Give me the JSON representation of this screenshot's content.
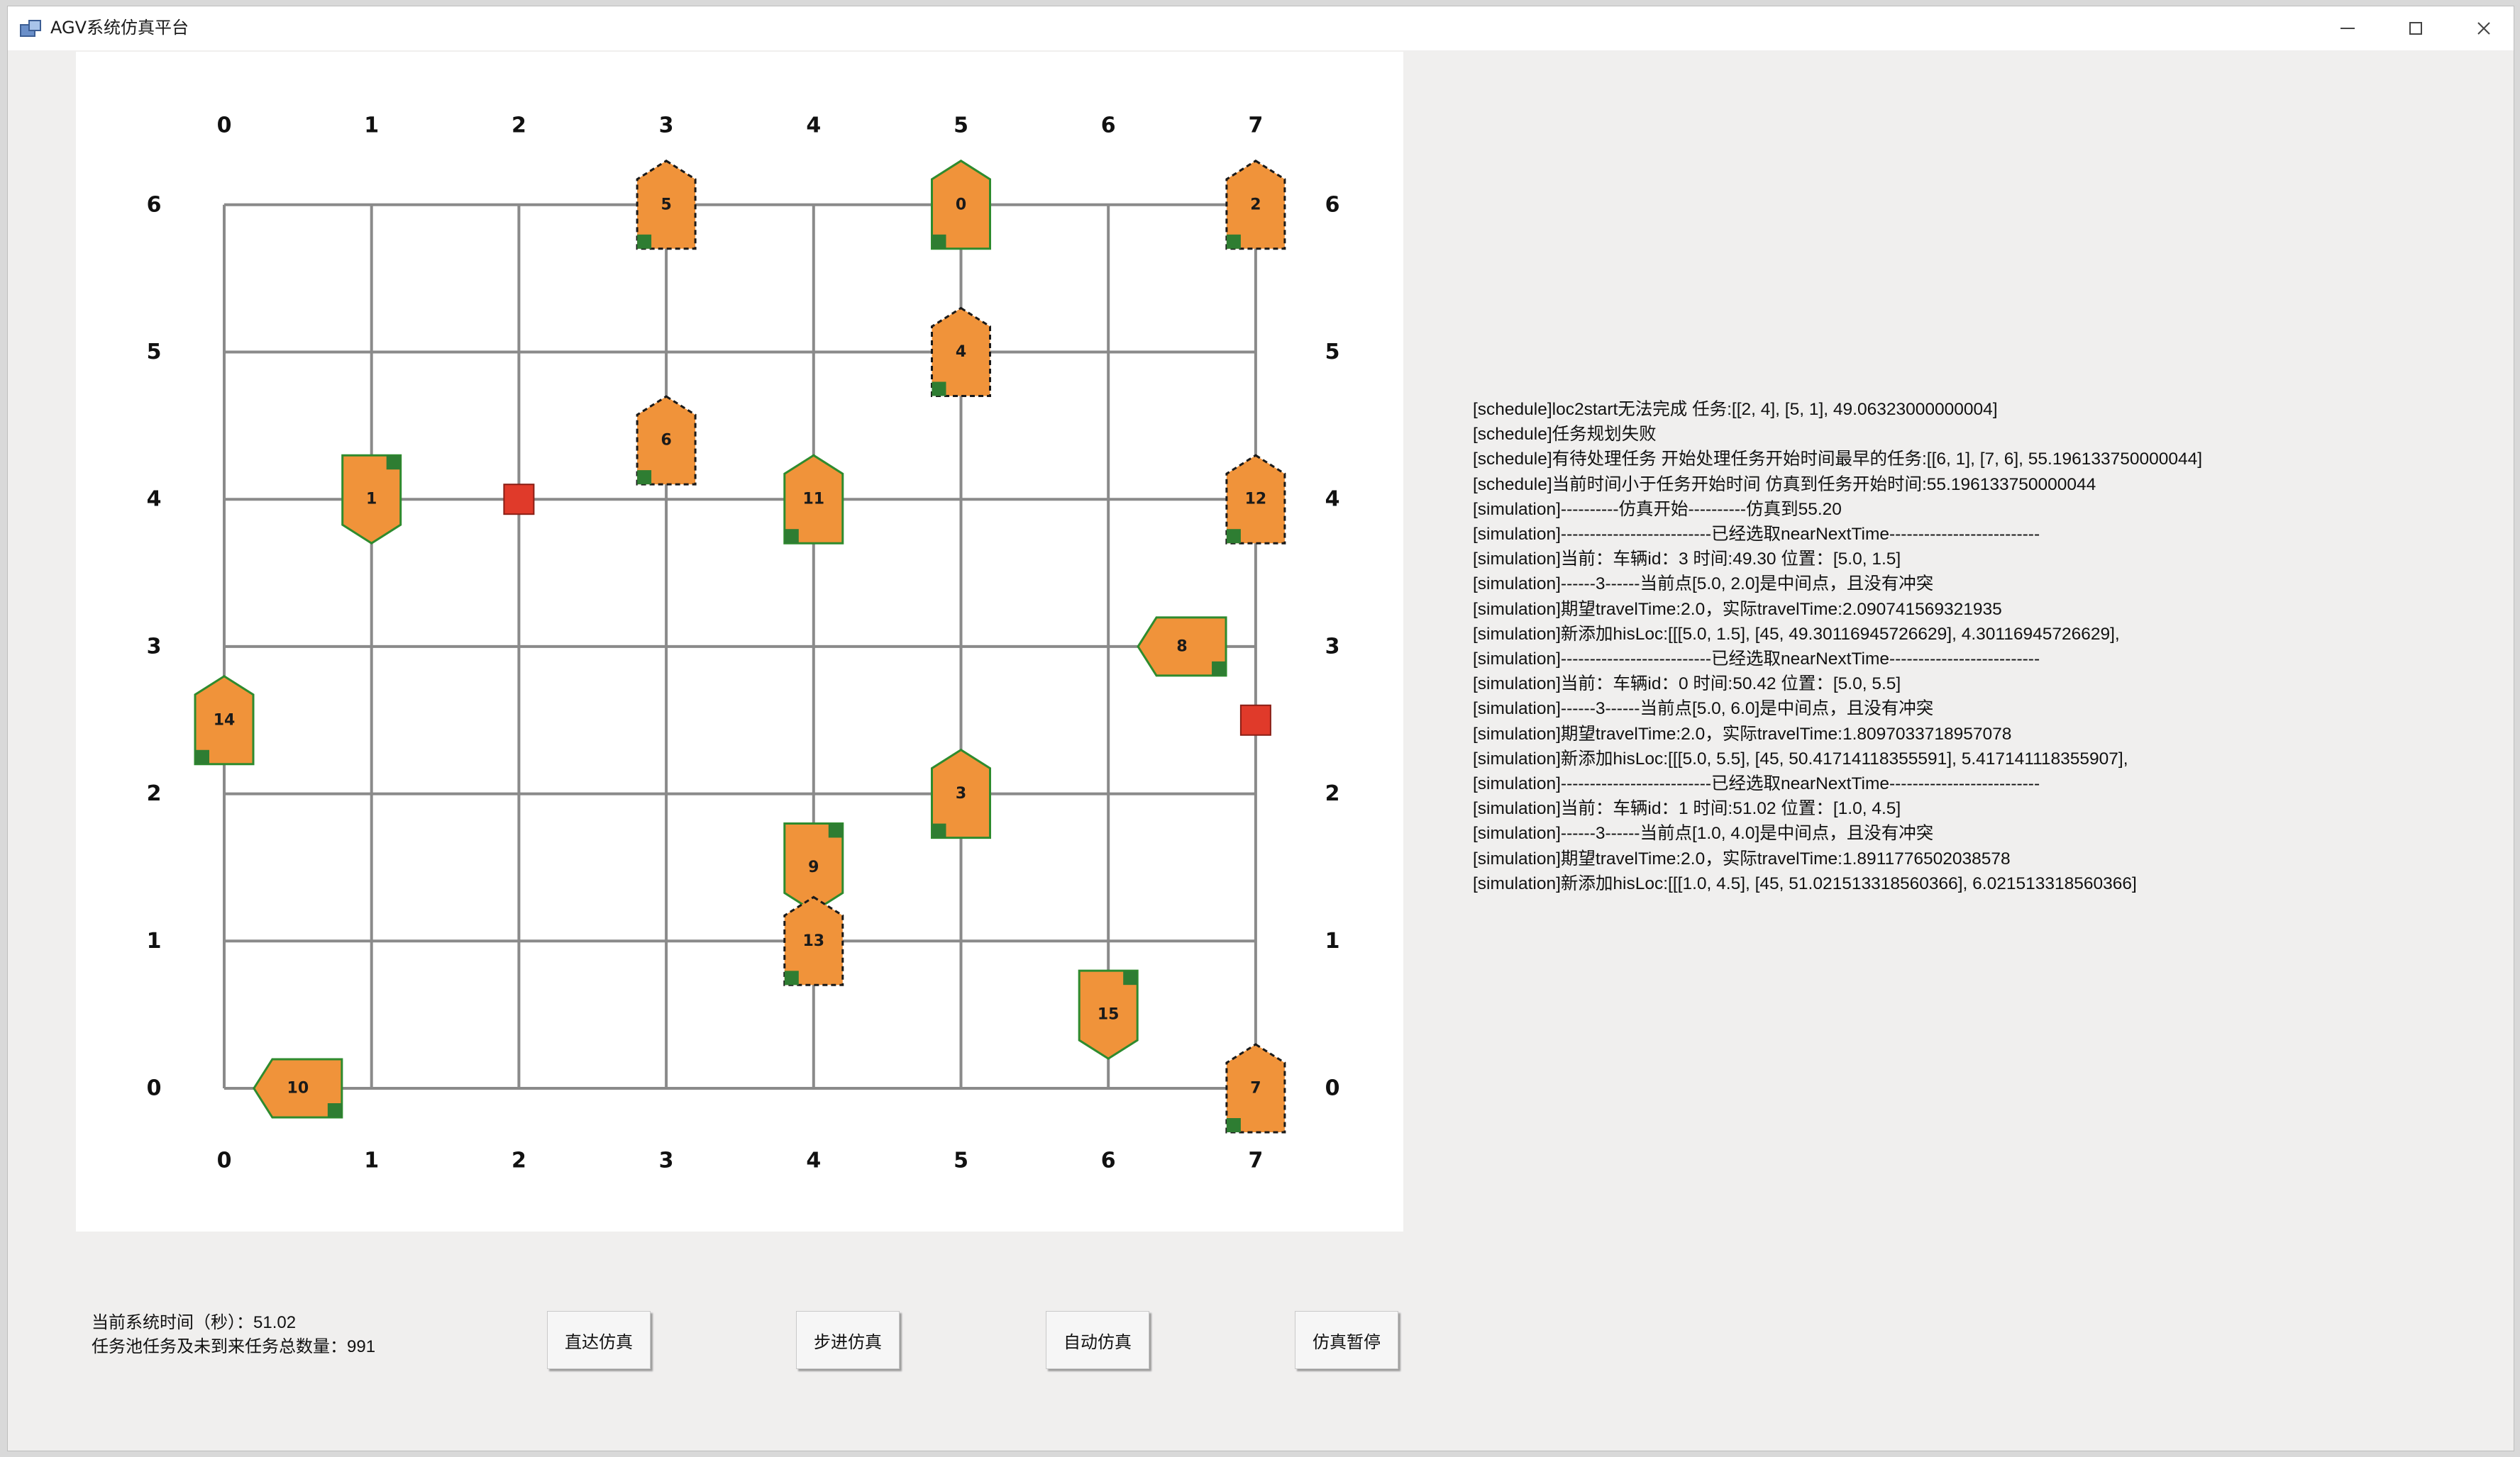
{
  "window": {
    "title": "AGV系统仿真平台",
    "controls": [
      "minimize-icon",
      "maximize-icon",
      "close-icon"
    ]
  },
  "grid": {
    "cols": [
      0,
      1,
      2,
      3,
      4,
      5,
      6,
      7
    ],
    "rows": [
      0,
      1,
      2,
      3,
      4,
      5,
      6
    ],
    "top_labels": [
      "0",
      "1",
      "2",
      "3",
      "4",
      "5",
      "6",
      "7"
    ],
    "bottom_labels": [
      "0",
      "1",
      "2",
      "3",
      "4",
      "5",
      "6",
      "7"
    ],
    "left_labels": [
      "6",
      "5",
      "4",
      "3",
      "2",
      "1",
      "0"
    ],
    "right_labels": [
      "6",
      "5",
      "4",
      "3",
      "2",
      "1",
      "0"
    ]
  },
  "colors": {
    "agv_fill": "#f0933a",
    "agv_border_solid": "#2e8b2e",
    "agv_border_dashed": "#1a1a1a",
    "marker_green": "#2e7d32",
    "obstacle_red": "#e03a2a",
    "grid_line": "#8a8a8a"
  },
  "vehicles": [
    {
      "id": "0",
      "x": 5,
      "y": 6,
      "dir": "up",
      "style": "solid"
    },
    {
      "id": "1",
      "x": 1,
      "y": 4,
      "dir": "down",
      "style": "solid"
    },
    {
      "id": "2",
      "x": 7,
      "y": 6,
      "dir": "up",
      "style": "dashed"
    },
    {
      "id": "3",
      "x": 5,
      "y": 2,
      "dir": "up",
      "style": "solid"
    },
    {
      "id": "4",
      "x": 5,
      "y": 5,
      "dir": "up",
      "style": "dashed"
    },
    {
      "id": "5",
      "x": 3,
      "y": 6,
      "dir": "up",
      "style": "dashed"
    },
    {
      "id": "6",
      "x": 3,
      "y": 4.4,
      "dir": "up",
      "style": "dashed"
    },
    {
      "id": "7",
      "x": 7,
      "y": 0,
      "dir": "up",
      "style": "dashed"
    },
    {
      "id": "8",
      "x": 6.5,
      "y": 3,
      "dir": "left",
      "style": "solid"
    },
    {
      "id": "9",
      "x": 4,
      "y": 1.5,
      "dir": "down",
      "style": "solid"
    },
    {
      "id": "10",
      "x": 0.5,
      "y": 0,
      "dir": "left",
      "style": "solid"
    },
    {
      "id": "11",
      "x": 4,
      "y": 4,
      "dir": "up",
      "style": "solid"
    },
    {
      "id": "12",
      "x": 7,
      "y": 4,
      "dir": "up",
      "style": "dashed"
    },
    {
      "id": "13",
      "x": 4,
      "y": 1,
      "dir": "up",
      "style": "dashed"
    },
    {
      "id": "14",
      "x": 0,
      "y": 2.5,
      "dir": "up",
      "style": "solid"
    },
    {
      "id": "15",
      "x": 6,
      "y": 0.5,
      "dir": "down",
      "style": "solid"
    }
  ],
  "obstacles": [
    {
      "x": 2,
      "y": 4
    },
    {
      "x": 7,
      "y": 2.5
    }
  ],
  "log_lines": [
    "[schedule]loc2start无法完成 任务:[[2, 4], [5, 1], 49.06323000000004]",
    "[schedule]任务规划失败",
    "[schedule]有待处理任务 开始处理任务开始时间最早的任务:[[6, 1], [7, 6], 55.196133750000044]",
    "[schedule]当前时间小于任务开始时间 仿真到任务开始时间:55.196133750000044",
    "[simulation]----------仿真开始----------仿真到55.20",
    "[simulation]--------------------------已经选取nearNextTime--------------------------",
    "[simulation]当前：车辆id：3 时间:49.30 位置：[5.0, 1.5]",
    "[simulation]------3------当前点[5.0, 2.0]是中间点，且没有冲突",
    "[simulation]期望travelTime:2.0，实际travelTime:2.090741569321935",
    "[simulation]新添加hisLoc:[[[5.0, 1.5], [45, 49.30116945726629], 4.30116945726629],",
    "[simulation]--------------------------已经选取nearNextTime--------------------------",
    "[simulation]当前：车辆id：0 时间:50.42 位置：[5.0, 5.5]",
    "[simulation]------3------当前点[5.0, 6.0]是中间点，且没有冲突",
    "[simulation]期望travelTime:2.0，实际travelTime:1.8097033718957078",
    "[simulation]新添加hisLoc:[[[5.0, 5.5], [45, 50.41714118355591], 5.417141118355907],",
    "[simulation]--------------------------已经选取nearNextTime--------------------------",
    "[simulation]当前：车辆id：1 时间:51.02 位置：[1.0, 4.5]",
    "[simulation]------3------当前点[1.0, 4.0]是中间点，且没有冲突",
    "[simulation]期望travelTime:2.0，实际travelTime:1.8911776502038578",
    "[simulation]新添加hisLoc:[[[1.0, 4.5], [45, 51.021513318560366], 6.021513318560366]"
  ],
  "status": {
    "time_label": "当前系统时间（秒）：51.02",
    "pool_label": "任务池任务及未到来任务总数量：991"
  },
  "buttons": {
    "direct": "直达仿真",
    "step": "步进仿真",
    "auto": "自动仿真",
    "pause": "仿真暂停"
  }
}
